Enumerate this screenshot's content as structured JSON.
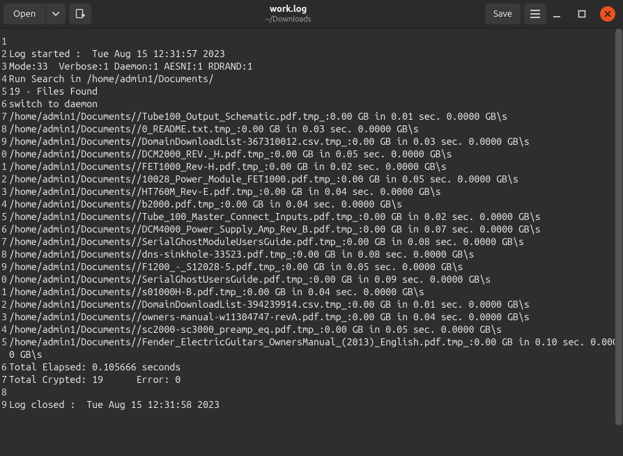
{
  "header": {
    "open": "Open",
    "save": "Save",
    "title": "work.log",
    "path": "~/Downloads"
  },
  "gutter": [
    "1",
    "2",
    "3",
    "4",
    "5",
    "6",
    "7",
    "8",
    "9",
    "0",
    "1",
    "2",
    "3",
    "4",
    "5",
    "6",
    "7",
    "8",
    "9",
    "0",
    "1",
    "2",
    "3",
    "4",
    "5",
    "6",
    "7",
    "8",
    "9"
  ],
  "lines": [
    "",
    "Log started :  Tue Aug 15 12:31:57 2023",
    "Mode:33  Verbose:1 Daemon:1 AESNI:1 RDRAND:1",
    "Run Search in /home/admin1/Documents/",
    "19 - Files Found",
    "switch to daemon",
    "/home/admin1/Documents//Tube100_Output_Schematic.pdf.tmp_:0.00 GB in 0.01 sec. 0.0000 GB\\s",
    "/home/admin1/Documents//0_README.txt.tmp_:0.00 GB in 0.03 sec. 0.0000 GB\\s",
    "/home/admin1/Documents//DomainDownloadList-367310012.csv.tmp_:0.00 GB in 0.03 sec. 0.0000 GB\\s",
    "/home/admin1/Documents//DCM2000_REV._H.pdf.tmp_:0.00 GB in 0.05 sec. 0.0000 GB\\s",
    "/home/admin1/Documents//FET1000_Rev-H.pdf.tmp_:0.00 GB in 0.02 sec. 0.0000 GB\\s",
    "/home/admin1/Documents//10028_Power_Module_FET1000.pdf.tmp_:0.00 GB in 0.05 sec. 0.0000 GB\\s",
    "/home/admin1/Documents//HT760M_Rev-E.pdf.tmp_:0.00 GB in 0.04 sec. 0.0000 GB\\s",
    "/home/admin1/Documents//b2000.pdf.tmp_:0.00 GB in 0.04 sec. 0.0000 GB\\s",
    "/home/admin1/Documents//Tube_100_Master_Connect_Inputs.pdf.tmp_:0.00 GB in 0.02 sec. 0.0000 GB\\s",
    "/home/admin1/Documents//DCM4000_Power_Supply_Amp_Rev_B.pdf.tmp_:0.00 GB in 0.07 sec. 0.0000 GB\\s",
    "/home/admin1/Documents//SerialGhostModuleUsersGuide.pdf.tmp_:0.00 GB in 0.08 sec. 0.0000 GB\\s",
    "/home/admin1/Documents//dns-sinkhole-33523.pdf.tmp_:0.00 GB in 0.08 sec. 0.0000 GB\\s",
    "/home/admin1/Documents//F1200_-_S12028-5.pdf.tmp_:0.00 GB in 0.05 sec. 0.0000 GB\\s",
    "/home/admin1/Documents//SerialGhostUsersGuide.pdf.tmp_:0.00 GB in 0.09 sec. 0.0000 GB\\s",
    "/home/admin1/Documents//s01000H-B.pdf.tmp_:0.00 GB in 0.04 sec. 0.0000 GB\\s",
    "/home/admin1/Documents//DomainDownloadList-394239914.csv.tmp_:0.00 GB in 0.01 sec. 0.0000 GB\\s",
    "/home/admin1/Documents//owners-manual-w11304747-revA.pdf.tmp_:0.00 GB in 0.04 sec. 0.0000 GB\\s",
    "/home/admin1/Documents//sc2000-sc3000_preamp_eq.pdf.tmp_:0.00 GB in 0.05 sec. 0.0000 GB\\s",
    "/home/admin1/Documents//Fender_ElectricGuitars_OwnersManual_(2013)_English.pdf.tmp_:0.00 GB in 0.10 sec. 0.0000 GB\\s",
    "Total Elapsed: 0.105666 seconds",
    "Total Crypted: 19      Error: 0",
    "",
    "Log closed :  Tue Aug 15 12:31:58 2023"
  ]
}
